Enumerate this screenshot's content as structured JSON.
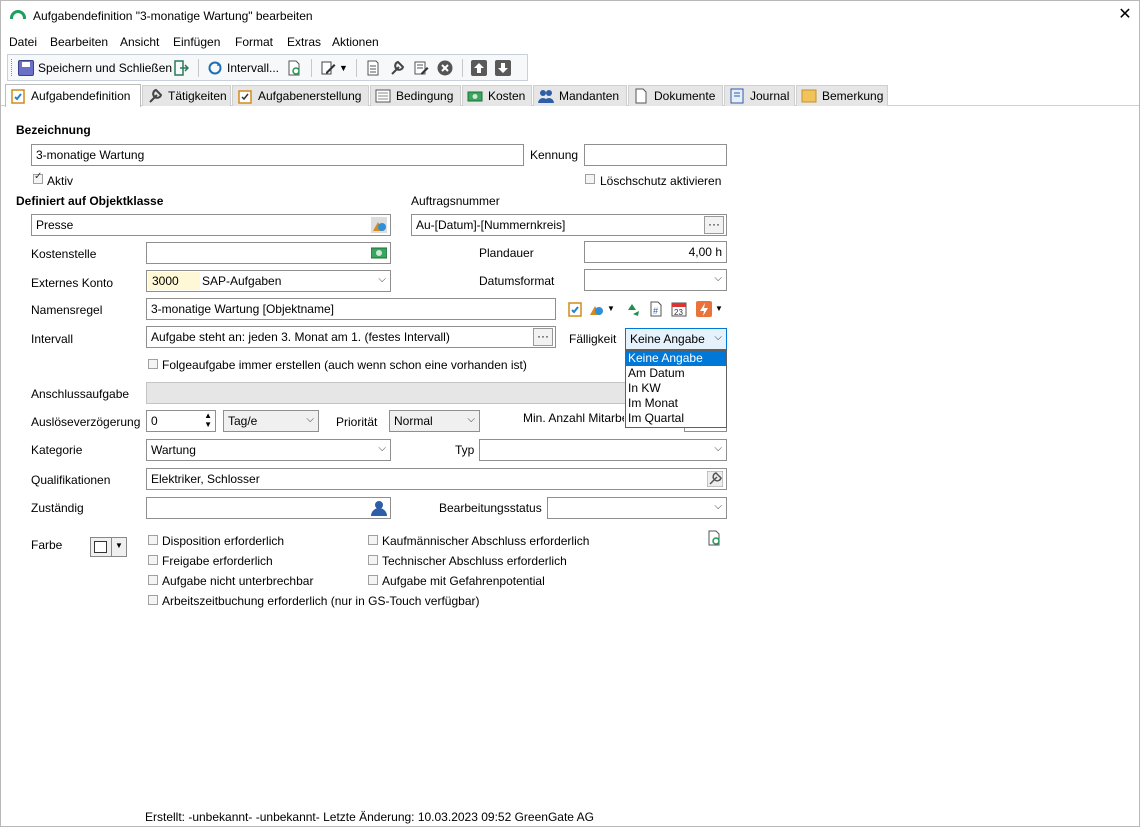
{
  "window": {
    "title": "Aufgabendefinition \"3-monatige Wartung\" bearbeiten",
    "close": "✕"
  },
  "menu": [
    "Datei",
    "Bearbeiten",
    "Ansicht",
    "Einfügen",
    "Format",
    "Extras",
    "Aktionen"
  ],
  "toolbar": {
    "save_close": "Speichern und Schließen",
    "intervall": "Intervall..."
  },
  "tabs": [
    "Aufgabendefinition",
    "Tätigkeiten",
    "Aufgabenerstellung",
    "Bedingung",
    "Kosten",
    "Mandanten",
    "Dokumente",
    "Journal",
    "Bemerkung"
  ],
  "form": {
    "bezeichnung_label": "Bezeichnung",
    "bezeichnung_value": "3-monatige Wartung",
    "kennung_label": "Kennung",
    "kennung_value": "",
    "aktiv_label": "Aktiv",
    "aktiv_checked": true,
    "loeschschutz_label": "Löschschutz aktivieren",
    "definiert_label": "Definiert auf Objektklasse",
    "objektklasse_value": "Presse",
    "auftragsnummer_label": "Auftragsnummer",
    "auftragsnummer_value": "Au-[Datum]-[Nummernkreis]",
    "kostenstelle_label": "Kostenstelle",
    "kostenstelle_value": "",
    "plandauer_label": "Plandauer",
    "plandauer_value": "4,00 h",
    "externes_konto_label": "Externes Konto",
    "externes_konto_code": "3000",
    "externes_konto_name": "SAP-Aufgaben",
    "datumsformat_label": "Datumsformat",
    "datumsformat_value": "",
    "namensregel_label": "Namensregel",
    "namensregel_value": "3-monatige Wartung [Objektname]",
    "intervall_label": "Intervall",
    "intervall_value": "Aufgabe steht an: jeden 3. Monat am 1.  (festes Intervall)",
    "faelligkeit_label": "Fälligkeit",
    "faelligkeit_value": "Keine Angabe",
    "faelligkeit_options": [
      "Keine Angabe",
      "Am Datum",
      "In KW",
      "Im Monat",
      "Im Quartal"
    ],
    "folgeaufgabe_label": "Folgeaufgabe immer erstellen (auch wenn schon eine vorhanden ist)",
    "anschlussaufgabe_label": "Anschlussaufgabe",
    "ausloese_label": "Auslöseverzögerung",
    "ausloese_value": "0",
    "ausloese_unit": "Tag/e",
    "prioritaet_label": "Priorität",
    "prioritaet_value": "Normal",
    "min_anzahl_label": "Min. Anzahl Mitarbeiter",
    "kategorie_label": "Kategorie",
    "kategorie_value": "Wartung",
    "typ_label": "Typ",
    "typ_value": "",
    "qualifikationen_label": "Qualifikationen",
    "qualifikationen_value": "Elektriker, Schlosser",
    "zustaendig_label": "Zuständig",
    "zustaendig_value": "",
    "bearbeitungsstatus_label": "Bearbeitungsstatus",
    "bearbeitungsstatus_value": "",
    "farbe_label": "Farbe",
    "checkboxes_left": [
      "Disposition erforderlich",
      "Freigabe erforderlich",
      "Aufgabe nicht unterbrechbar",
      "Arbeitszeitbuchung erforderlich (nur in GS-Touch verfügbar)"
    ],
    "checkboxes_right": [
      "Kaufmännischer Abschluss erforderlich",
      "Technischer Abschluss erforderlich",
      "Aufgabe mit Gefahrenpotential"
    ]
  },
  "status": {
    "text": "Erstellt: -unbekannt- -unbekannt-  Letzte Änderung: 10.03.2023 09:52 GreenGate AG"
  },
  "colors": {
    "accent": "#0078d7",
    "brand": "#1da05b"
  }
}
